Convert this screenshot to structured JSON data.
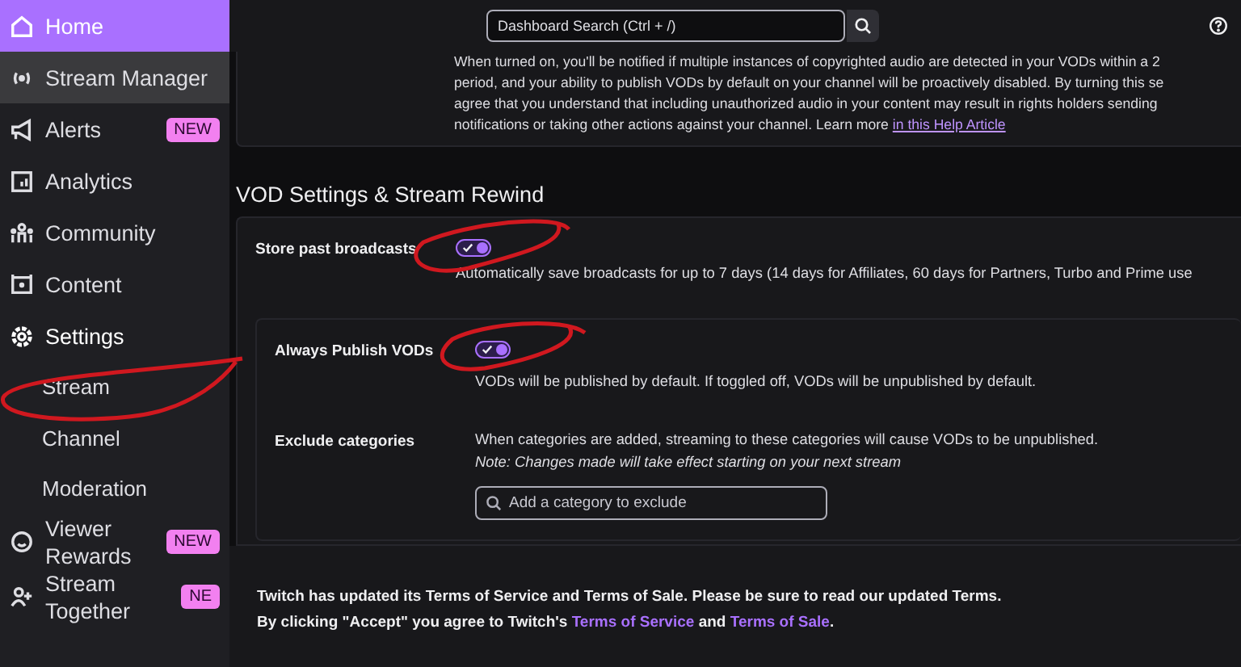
{
  "sidebar": {
    "items": [
      {
        "label": "Home",
        "selected": true,
        "hovered": false
      },
      {
        "label": "Stream Manager",
        "selected": false,
        "hovered": true
      },
      {
        "label": "Alerts",
        "selected": false,
        "hovered": false,
        "badge": "NEW"
      },
      {
        "label": "Analytics",
        "selected": false,
        "hovered": false
      },
      {
        "label": "Community",
        "selected": false,
        "hovered": false
      },
      {
        "label": "Content",
        "selected": false,
        "hovered": false
      },
      {
        "label": "Settings",
        "selected": false,
        "hovered": false,
        "expanded": true,
        "children": [
          {
            "label": "Stream",
            "selected": false
          },
          {
            "label": "Channel",
            "selected": false
          },
          {
            "label": "Moderation",
            "selected": false
          }
        ]
      },
      {
        "label": "Viewer Rewards",
        "selected": false,
        "hovered": false,
        "badge": "NEW"
      },
      {
        "label": "Stream Together",
        "selected": false,
        "hovered": false,
        "badge": "NE"
      }
    ]
  },
  "top_bar": {
    "search": {
      "placeholder": "Dashboard Search (Ctrl + /)"
    }
  },
  "copyright_card": {
    "lines": [
      "When turned on, you'll be notified if multiple instances of copyrighted audio are detected in your VODs within a 2",
      "period, and your ability to publish VODs by default on your channel will be proactively disabled. By turning this se",
      "agree that you understand that including unauthorized audio in your content may result in rights holders sending",
      "notifications or taking other actions against your channel. Learn more"
    ],
    "link": "in this Help Article"
  },
  "section": {
    "title": "VOD Settings & Stream Rewind",
    "store": {
      "label": "Store past broadcasts",
      "on": true,
      "description": "Automatically save broadcasts for up to 7 days (14 days for Affiliates, 60 days for Partners, Turbo and Prime use"
    },
    "publish": {
      "label": "Always Publish VODs",
      "on": true,
      "description": "VODs will be published by default. If toggled off, VODs will be unpublished by default."
    },
    "exclude": {
      "label": "Exclude categories",
      "description": "When categories are added, streaming to these categories will cause VODs to be unpublished.",
      "note": "Note: Changes made will take effect starting on your next stream",
      "placeholder": "Add a category to exclude"
    }
  },
  "banner": {
    "line1": "Twitch has updated its Terms of Service and Terms of Sale. Please be sure to read our updated Terms.",
    "line2_start": "By clicking \"Accept\" you agree to Twitch's",
    "link1": "Terms of Service",
    "joiner": "and",
    "link2": "Terms of Sale",
    "end": "."
  }
}
